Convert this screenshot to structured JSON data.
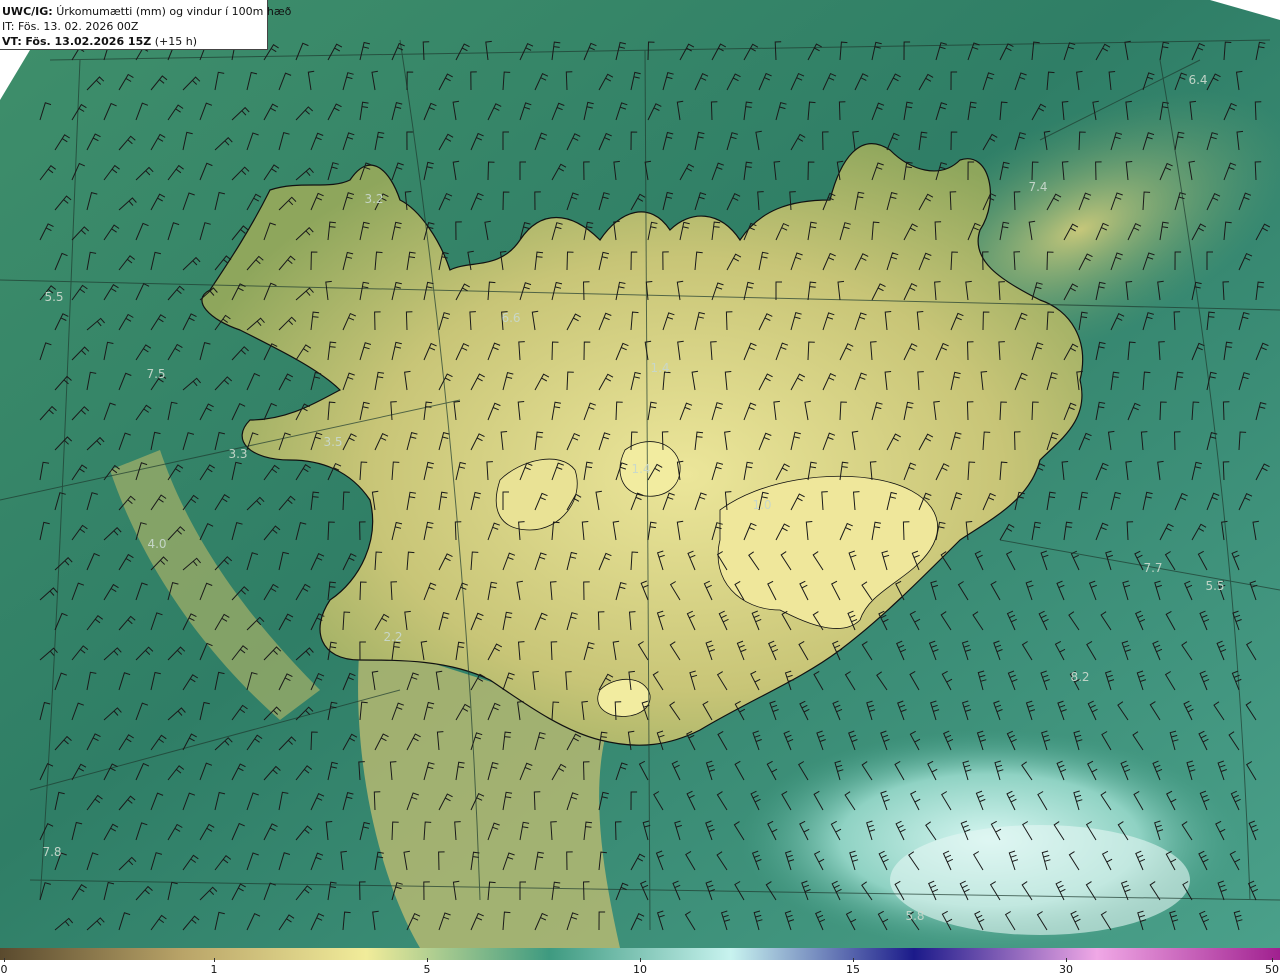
{
  "header": {
    "product_code": "UWC/IG:",
    "title": "Úrkomumætti (mm) og vindur í 100m hæð",
    "it_prefix": "IT:",
    "it_value": "Fös. 13. 02. 2026 00Z",
    "vt_prefix": "VT:",
    "vt_value": "Fös. 13.02.2026 15Z",
    "lead": "(+15 h)"
  },
  "value_labels": [
    {
      "text": "6.4"
    },
    {
      "text": "3.2"
    },
    {
      "text": "7.4"
    },
    {
      "text": "5.5"
    },
    {
      "text": "6.6"
    },
    {
      "text": "7.5"
    },
    {
      "text": "1.4"
    },
    {
      "text": "3.5"
    },
    {
      "text": "3.3"
    },
    {
      "text": "1.4"
    },
    {
      "text": "1.0"
    },
    {
      "text": "4.0"
    },
    {
      "text": "7.7"
    },
    {
      "text": "5.5"
    },
    {
      "text": "2.2"
    },
    {
      "text": "8.2"
    },
    {
      "text": "7.8"
    },
    {
      "text": "5.8"
    }
  ],
  "colorbar": {
    "ticks": [
      "0",
      "1",
      "5",
      "10",
      "15",
      "30",
      "50"
    ],
    "colors": [
      "#5a4a2e",
      "#b9a468",
      "#f1ec9a",
      "#3e9a80",
      "#c8f3ef",
      "#1b1a8a",
      "#f0a8e6",
      "#a0208f"
    ]
  },
  "colors": {
    "sea": "#2f7c63",
    "land_low": "#a7b35e",
    "land_high": "#e8e393",
    "coast": "#111111"
  }
}
